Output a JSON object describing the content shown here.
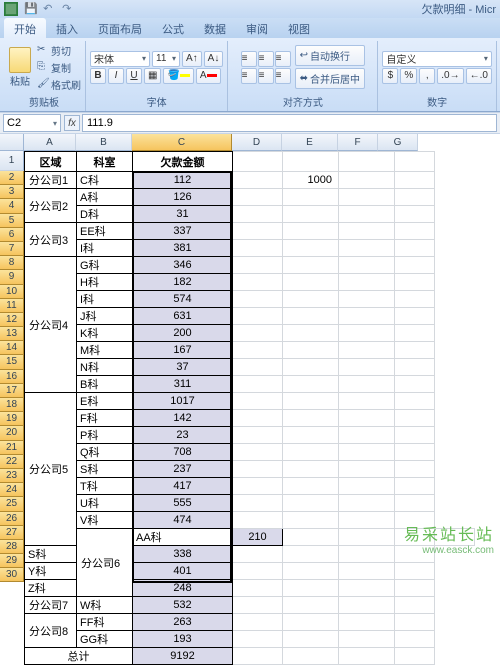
{
  "window": {
    "title": "欠款明细 - Micr"
  },
  "tabs": [
    "开始",
    "插入",
    "页面布局",
    "公式",
    "数据",
    "审阅",
    "视图"
  ],
  "activeTab": 0,
  "ribbon": {
    "clipboard": {
      "paste": "粘贴",
      "cut": "剪切",
      "copy": "复制",
      "format": "格式刷",
      "group": "剪贴板"
    },
    "font": {
      "name": "宋体",
      "size": "11",
      "bold": "B",
      "italic": "I",
      "underline": "U",
      "group": "字体"
    },
    "align": {
      "wrap": "自动换行",
      "merge": "合并后居中",
      "group": "对齐方式"
    },
    "number": {
      "format": "自定义",
      "group": "数字"
    }
  },
  "formula": {
    "ref": "C2",
    "fx": "fx",
    "value": "111.9"
  },
  "cols": [
    "A",
    "B",
    "C",
    "D",
    "E",
    "F",
    "G"
  ],
  "selectedCol": 2,
  "firstRow": 1,
  "headers": {
    "A": "区域",
    "B": "科室",
    "C": "欠款金额"
  },
  "extra": {
    "E2": "1000"
  },
  "rows": [
    {
      "a": "分公司1",
      "aspan": 1,
      "b": "C科",
      "c": "112"
    },
    {
      "a": "分公司2",
      "aspan": 2,
      "b": "A科",
      "c": "126"
    },
    {
      "b": "D科",
      "c": "31"
    },
    {
      "a": "分公司3",
      "aspan": 2,
      "b": "EE科",
      "c": "337"
    },
    {
      "b": "I科",
      "c": "381"
    },
    {
      "a": "分公司4",
      "aspan": 8,
      "b": "G科",
      "c": "346"
    },
    {
      "b": "H科",
      "c": "182"
    },
    {
      "b": "I科",
      "c": "574"
    },
    {
      "b": "J科",
      "c": "631"
    },
    {
      "b": "K科",
      "c": "200"
    },
    {
      "b": "M科",
      "c": "167"
    },
    {
      "b": "N科",
      "c": "37"
    },
    {
      "b": "B科",
      "c": "311"
    },
    {
      "a": "分公司5",
      "aspan": 9,
      "b": "E科",
      "c": "1017"
    },
    {
      "b": "F科",
      "c": "142"
    },
    {
      "b": "P科",
      "c": "23"
    },
    {
      "b": "Q科",
      "c": "708"
    },
    {
      "b": "S科",
      "c": "237"
    },
    {
      "b": "T科",
      "c": "417"
    },
    {
      "b": "U科",
      "c": "555"
    },
    {
      "b": "V科",
      "c": "474"
    },
    {
      "a": "分公司6",
      "aspan": 4,
      "b": "AA科",
      "c": "210"
    },
    {
      "b": "S科",
      "c": "338"
    },
    {
      "b": "Y科",
      "c": "401"
    },
    {
      "b": "Z科",
      "c": "248"
    },
    {
      "a": "分公司7",
      "aspan": 1,
      "b": "W科",
      "c": "532"
    },
    {
      "a": "分公司8",
      "aspan": 2,
      "b": "FF科",
      "c": "263"
    },
    {
      "b": "GG科",
      "c": "193"
    }
  ],
  "total": {
    "label": "总计",
    "value": "9192"
  },
  "watermark": {
    "l1": "易采站长站",
    "l2": "www.easck.com"
  }
}
